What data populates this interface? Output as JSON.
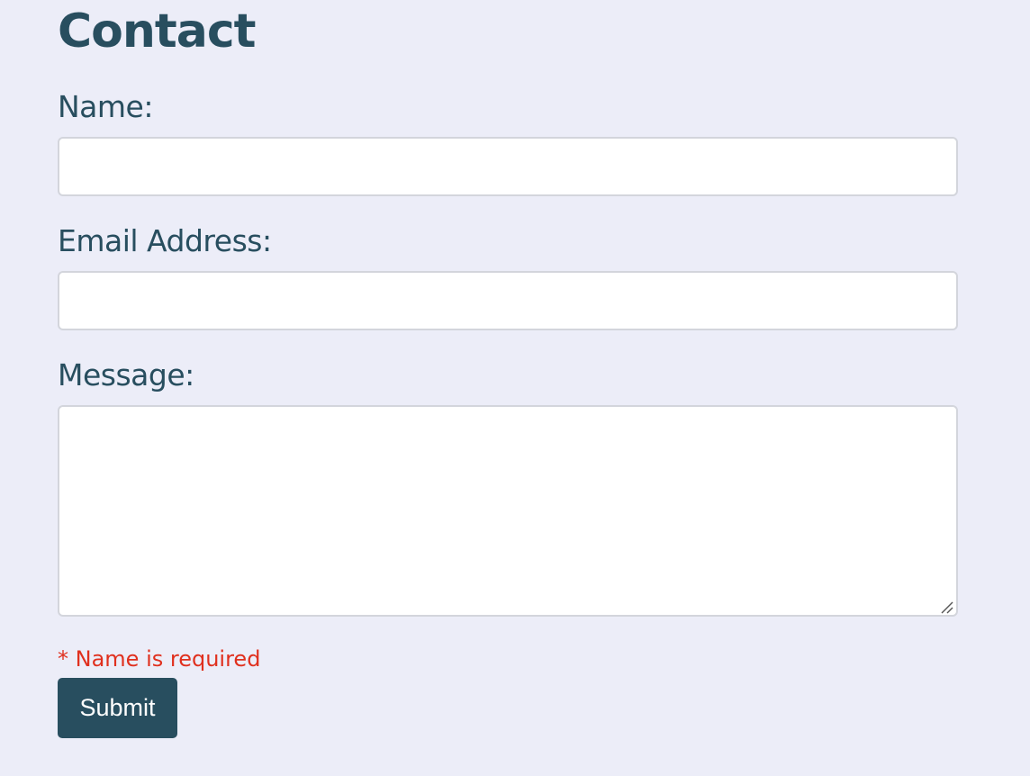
{
  "page": {
    "title": "Contact"
  },
  "form": {
    "name_label": "Name:",
    "name_value": "",
    "email_label": "Email Address:",
    "email_value": "",
    "message_label": "Message:",
    "message_value": "",
    "error_message": "* Name is required",
    "submit_label": "Submit"
  },
  "colors": {
    "background": "#ecedf8",
    "text": "#284e5f",
    "button": "#284e5f",
    "button_text": "#ffffff",
    "error": "#e0301e",
    "input_border": "#d3d5dc"
  },
  "icons": {
    "resize_handle": "resize-handle-icon"
  }
}
